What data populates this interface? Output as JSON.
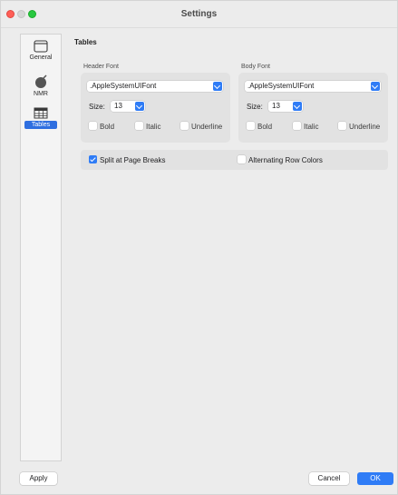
{
  "window": {
    "title": "Settings"
  },
  "sidebar": {
    "items": [
      {
        "label": "General",
        "icon": "window-icon",
        "active": false
      },
      {
        "label": "NMR",
        "icon": "magnet-icon",
        "active": false
      },
      {
        "label": "Tables",
        "icon": "table-icon",
        "active": true
      }
    ]
  },
  "main": {
    "section_title": "Tables",
    "header_font": {
      "label": "Header Font",
      "font": ".AppleSystemUIFont",
      "size_label": "Size:",
      "size": "13",
      "bold": "Bold",
      "bold_checked": false,
      "italic": "Italic",
      "italic_checked": false,
      "underline": "Underline",
      "underline_checked": false
    },
    "body_font": {
      "label": "Body Font",
      "font": ".AppleSystemUIFont",
      "size_label": "Size:",
      "size": "13",
      "bold": "Bold",
      "bold_checked": false,
      "italic": "Italic",
      "italic_checked": false,
      "underline": "Underline",
      "underline_checked": false
    },
    "options": {
      "split": "Split at Page Breaks",
      "split_checked": true,
      "alternating": "Alternating Row Colors",
      "alternating_checked": false
    }
  },
  "footer": {
    "apply": "Apply",
    "cancel": "Cancel",
    "ok": "OK"
  },
  "colors": {
    "accent": "#2f7cf6",
    "selection": "#2f6fe0",
    "close": "#ff5f57",
    "maximize": "#28c840"
  }
}
